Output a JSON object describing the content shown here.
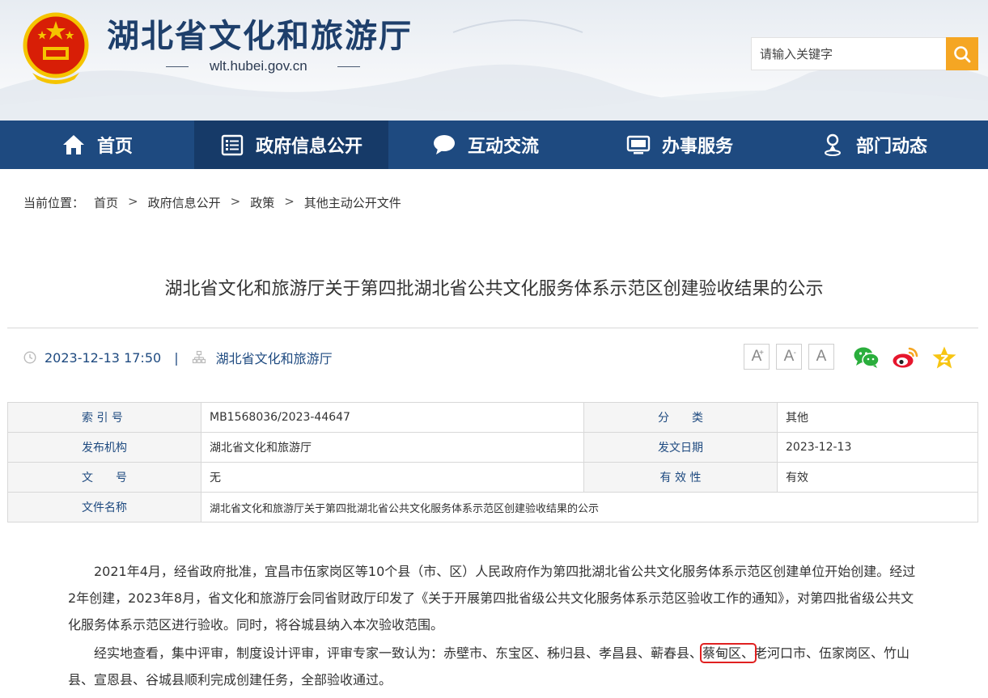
{
  "header": {
    "site_title": "湖北省文化和旅游厅",
    "site_domain": "wlt.hubei.gov.cn",
    "search_placeholder": "请输入关键字"
  },
  "nav": {
    "items": [
      {
        "label": "首页",
        "icon": "home-icon"
      },
      {
        "label": "政府信息公开",
        "icon": "document-list-icon"
      },
      {
        "label": "互动交流",
        "icon": "chat-bubble-icon"
      },
      {
        "label": "办事服务",
        "icon": "monitor-icon"
      },
      {
        "label": "部门动态",
        "icon": "location-person-icon"
      }
    ],
    "active_index": 1
  },
  "breadcrumb": {
    "lead": "当前位置：",
    "items": [
      "首页",
      "政府信息公开",
      "政策",
      "其他主动公开文件"
    ],
    "separator": ">"
  },
  "article": {
    "title": "湖北省文化和旅游厅关于第四批湖北省公共文化服务体系示范区创建验收结果的公示",
    "datetime": "2023-12-13 17:50",
    "meta_separator": "|",
    "source": "湖北省文化和旅游厅",
    "font_controls": [
      "A",
      "A",
      "A"
    ],
    "font_control_marks": [
      "+",
      "-",
      ""
    ],
    "share_icons": [
      "wechat-icon",
      "weibo-icon",
      "favorite-star-icon"
    ]
  },
  "info_table": {
    "rows": [
      {
        "label1": "索 引 号",
        "value1": "MB1568036/2023-44647",
        "label2": "分　　类",
        "value2": "其他"
      },
      {
        "label1": "发布机构",
        "value1": "湖北省文化和旅游厅",
        "label2": "发文日期",
        "value2": "2023-12-13"
      },
      {
        "label1": "文　　号",
        "value1": "无",
        "label2": "有 效 性",
        "value2": "有效"
      },
      {
        "label1": "文件名称",
        "value1": "湖北省文化和旅游厅关于第四批湖北省公共文化服务体系示范区创建验收结果的公示"
      }
    ]
  },
  "body": {
    "para1": "2021年4月，经省政府批准，宜昌市伍家岗区等10个县（市、区）人民政府作为第四批湖北省公共文化服务体系示范区创建单位开始创建。经过2年创建，2023年8月，省文化和旅游厅会同省财政厅印发了《关于开展第四批省级公共文化服务体系示范区验收工作的通知》，对第四批省级公共文化服务体系示范区进行验收。同时，将谷城县纳入本次验收范围。",
    "para2_before": "经实地查看，集中评审，制度设计评审，评审专家一致认为：赤壁市、东宝区、秭归县、孝昌县、蕲春县、",
    "para2_highlight": "蔡甸区、",
    "para2_after": "老河口市、伍家岗区、竹山县、宣恩县、谷城县顺利完成创建任务，全部验收通过。"
  },
  "colors": {
    "nav_bg": "#1e4a80",
    "nav_active": "#163a68",
    "title_blue": "#1e3f6b",
    "accent_orange": "#f5a623",
    "highlight_red": "#e02020"
  }
}
